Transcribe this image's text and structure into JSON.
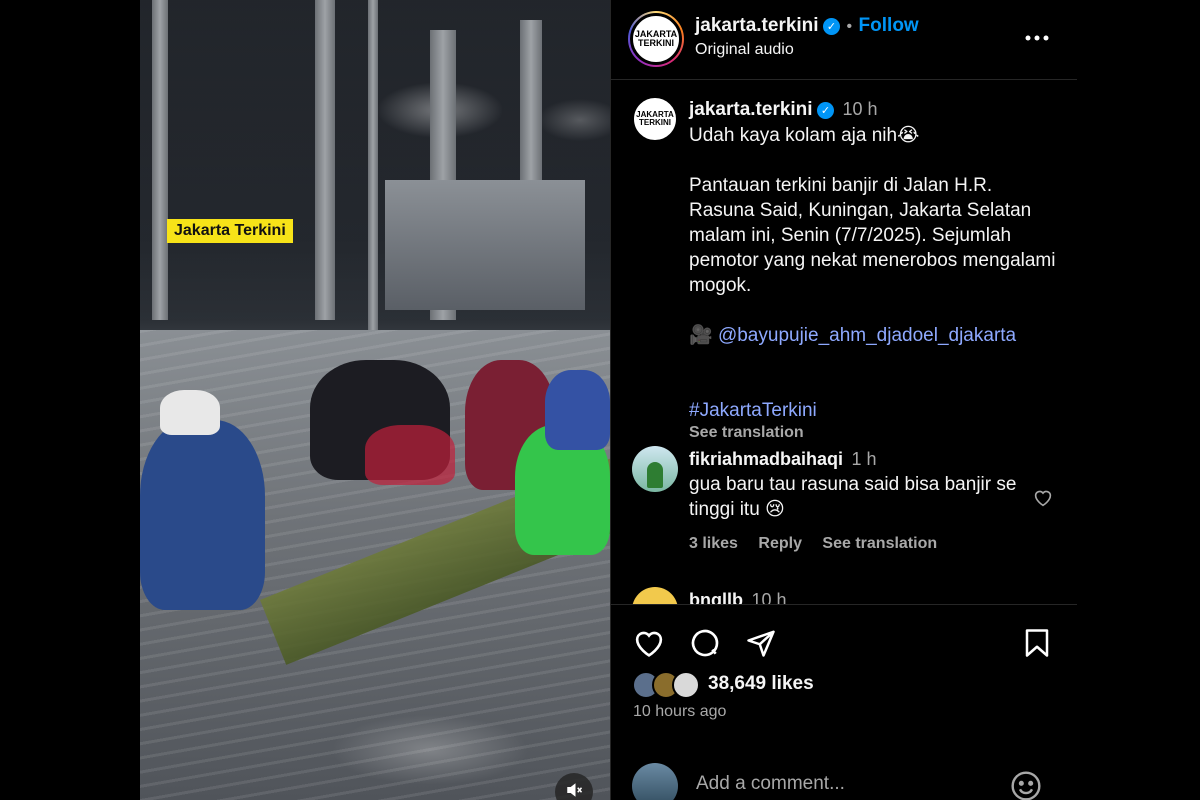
{
  "media": {
    "overlay_label": "Jakarta Terkini",
    "mute_icon": "speaker-muted-icon"
  },
  "header": {
    "avatar_text": "JAKARTA TERKINI",
    "username": "jakarta.terkini",
    "verified_icon": "verified-badge-icon",
    "separator": "•",
    "follow_label": "Follow",
    "audio_label": "Original audio",
    "more_icon": "more-options-icon"
  },
  "caption": {
    "avatar_text": "JAKARTA TERKINI",
    "username": "jakarta.terkini",
    "time": "10 h",
    "line1": "Udah kaya kolam aja nih😭",
    "body": "Pantauan terkini banjir di Jalan H.R. Rasuna Said, Kuningan, Jakarta Selatan malam ini, Senin (7/7/2025). Sejumlah pemotor yang nekat menerobos mengalami mogok.",
    "camera_emoji": "🎥",
    "mention": "@bayupujie_ahm_djadoel_djakarta",
    "hashtag": "#JakartaTerkini",
    "see_translation": "See translation"
  },
  "comments": [
    {
      "username": "fikriahmadbaihaqi",
      "time": "1 h",
      "text": "gua baru tau rasuna said bisa banjir se tinggi itu 😢",
      "likes": "3 likes",
      "reply": "Reply",
      "see_translation": "See translation"
    },
    {
      "username": "bnqllb",
      "time": "10 h"
    }
  ],
  "actions": {
    "like_icon": "heart-icon",
    "comment_icon": "comment-icon",
    "share_icon": "send-icon",
    "save_icon": "bookmark-icon",
    "likes_count": "38,649 likes",
    "posted": "10 hours ago",
    "comment_placeholder": "Add a comment...",
    "emoji_icon": "emoji-smile-icon"
  },
  "colors": {
    "background": "#000000",
    "accent": "#0095f6",
    "secondary_text": "#a8a8a8",
    "overlay_label_bg": "#f7e318"
  }
}
